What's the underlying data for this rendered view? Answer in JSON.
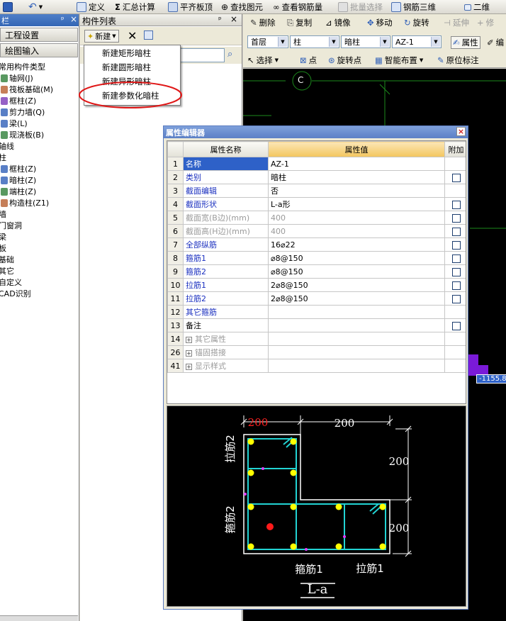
{
  "toolbar": {
    "define": "定义",
    "sum_calc": "汇总计算",
    "align_top": "平齐板顶",
    "find_element": "查找图元",
    "view_rebar_qty": "查看钢筋量",
    "batch_select": "批量选择",
    "rebar_3d": "钢筋三维",
    "view_2d": "二维"
  },
  "left_panel": {
    "title": "栏",
    "project_settings": "工程设置",
    "drawing_input": "绘图输入",
    "tree": [
      {
        "label": "常用构件类型",
        "indent": 0
      },
      {
        "label": "轴网(J)",
        "indent": 1
      },
      {
        "label": "筏板基础(M)",
        "indent": 1
      },
      {
        "label": "框柱(Z)",
        "indent": 1
      },
      {
        "label": "剪力墙(Q)",
        "indent": 1
      },
      {
        "label": "梁(L)",
        "indent": 1
      },
      {
        "label": "现浇板(B)",
        "indent": 1
      },
      {
        "label": "轴线",
        "indent": 0
      },
      {
        "label": "柱",
        "indent": 0
      },
      {
        "label": "框柱(Z)",
        "indent": 1
      },
      {
        "label": "暗柱(Z)",
        "indent": 1
      },
      {
        "label": "端柱(Z)",
        "indent": 1
      },
      {
        "label": "构造柱(Z1)",
        "indent": 1
      },
      {
        "label": "墙",
        "indent": 0
      },
      {
        "label": "门窗洞",
        "indent": 0
      },
      {
        "label": "梁",
        "indent": 0
      },
      {
        "label": "板",
        "indent": 0
      },
      {
        "label": "基础",
        "indent": 0
      },
      {
        "label": "其它",
        "indent": 0
      },
      {
        "label": "自定义",
        "indent": 0
      },
      {
        "label": "CAD识别",
        "indent": 0
      }
    ]
  },
  "component_list": {
    "title": "构件列表",
    "new_label": "新建",
    "menu": [
      "新建矩形暗柱",
      "新建圆形暗柱",
      "新建异形暗柱",
      "新建参数化暗柱"
    ],
    "highlighted_item": "新建参数化暗柱"
  },
  "right_toolbar": {
    "delete": "删除",
    "copy": "复制",
    "mirror": "镜像",
    "move": "移动",
    "rotate": "旋转",
    "extend": "延伸",
    "modify": "修",
    "floor": "首层",
    "category": "柱",
    "type": "暗柱",
    "component": "AZ-1",
    "properties": "属性",
    "edit": "编",
    "select": "选择",
    "point": "点",
    "rotate_point": "旋转点",
    "smart_place": "智能布置",
    "in_place_label": "原位标注"
  },
  "canvas": {
    "axis_label": "C",
    "dimension": "-1155.8"
  },
  "property_editor": {
    "title": "属性编辑器",
    "col_name": "属性名称",
    "col_value": "属性值",
    "col_extra": "附加",
    "rows": [
      {
        "no": "1",
        "name": "名称",
        "value": "AZ-1",
        "style": "selected",
        "check": false
      },
      {
        "no": "2",
        "name": "类别",
        "value": "暗柱",
        "style": "blue",
        "check": true
      },
      {
        "no": "3",
        "name": "截面编辑",
        "value": "否",
        "style": "blue",
        "check": false
      },
      {
        "no": "4",
        "name": "截面形状",
        "value": "L-a形",
        "style": "blue",
        "check": true
      },
      {
        "no": "5",
        "name": "截面宽(B边)(mm)",
        "value": "400",
        "style": "grey",
        "check": true
      },
      {
        "no": "6",
        "name": "截面高(H边)(mm)",
        "value": "400",
        "style": "grey",
        "check": true
      },
      {
        "no": "7",
        "name": "全部纵筋",
        "value": "16⌀22",
        "style": "blue",
        "check": true
      },
      {
        "no": "8",
        "name": "箍筋1",
        "value": "⌀8@150",
        "style": "blue",
        "check": true
      },
      {
        "no": "9",
        "name": "箍筋2",
        "value": "⌀8@150",
        "style": "blue",
        "check": true
      },
      {
        "no": "10",
        "name": "拉筋1",
        "value": "2⌀8@150",
        "style": "blue",
        "check": true
      },
      {
        "no": "11",
        "name": "拉筋2",
        "value": "2⌀8@150",
        "style": "blue",
        "check": true
      },
      {
        "no": "12",
        "name": "其它箍筋",
        "value": "",
        "style": "blue",
        "check": false
      },
      {
        "no": "13",
        "name": "备注",
        "value": "",
        "style": "black",
        "check": true
      },
      {
        "no": "14",
        "name": "其它属性",
        "value": "",
        "style": "group",
        "check": false
      },
      {
        "no": "26",
        "name": "锚固搭接",
        "value": "",
        "style": "group",
        "check": false
      },
      {
        "no": "41",
        "name": "显示样式",
        "value": "",
        "style": "group",
        "check": false
      }
    ]
  },
  "section_preview": {
    "dim_top_left": "200",
    "dim_top_right": "200",
    "dim_right_upper": "200",
    "dim_right_lower": "200",
    "label_tie2": "拉筋2",
    "label_stirrup2": "箍筋2",
    "label_stirrup1": "箍筋1",
    "label_tie1": "拉筋1",
    "shape_name": "L-a",
    "colors": {
      "outline": "#ffffff",
      "stirrup": "#22d3d3",
      "bar": "#ffff00",
      "center": "#ff1a1a",
      "highlight_dim": "#ff2020"
    }
  },
  "colors": {
    "accent": "#2e61c8",
    "highlight_circle": "#e01818",
    "canvas_grid": "#1c8a1c",
    "purple_marker": "#7a1ad8"
  }
}
